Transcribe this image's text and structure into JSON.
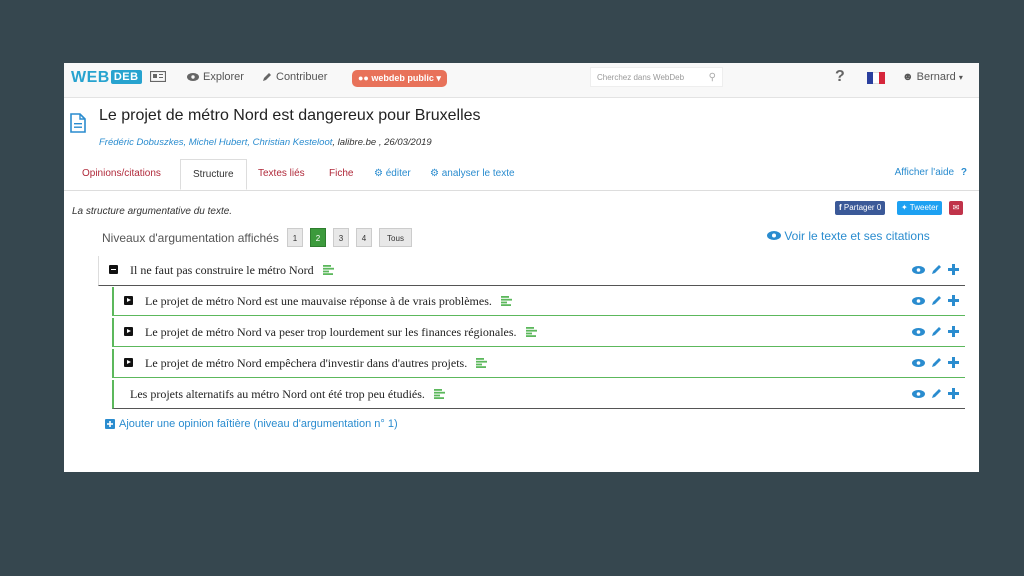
{
  "nav": {
    "logo_web": "WEB",
    "logo_deb": "DEB",
    "explorer": "Explorer",
    "contribuer": "Contribuer",
    "group_pill": "webdeb public",
    "search_placeholder": "Cherchez dans WebDeb",
    "help": "?",
    "user": "Bernard"
  },
  "document": {
    "title": "Le projet de métro Nord est dangereux pour Bruxelles",
    "authors": "Frédéric Dobuszkes, Michel Hubert, Christian Kesteloot",
    "source": ", lalibre.be , 26/03/2019"
  },
  "tabs": [
    {
      "label": "Opinions/citations"
    },
    {
      "label": "Structure"
    },
    {
      "label": "Textes liés"
    },
    {
      "label": "Fiche"
    },
    {
      "label": "éditer"
    },
    {
      "label": "analyser le texte"
    }
  ],
  "help_label": "Afficher l'aide",
  "description": "La structure argumentative du texte.",
  "share": {
    "facebook": "Partager 0",
    "twitter": "Tweeter"
  },
  "levels": {
    "label": "Niveaux d'argumentation affichés",
    "options": [
      "1",
      "2",
      "3",
      "4",
      "Tous"
    ],
    "selected": "2"
  },
  "voir_link": "Voir le texte et ses citations",
  "arguments": [
    {
      "text": "Il ne faut pas construire le métro Nord"
    },
    {
      "text": "Le projet de métro Nord est une mauvaise réponse à de vrais problèmes."
    },
    {
      "text": "Le projet de métro Nord va peser trop lourdement sur les finances régionales."
    },
    {
      "text": "Le projet de métro Nord empêchera d'investir dans d'autres projets."
    },
    {
      "text": "Les projets alternatifs au métro Nord ont été trop peu étudiés."
    }
  ],
  "add_opinion": "Ajouter une opinion faîtière (niveau d'argumentation n° 1)",
  "colors": {
    "accent": "#2a8ccf",
    "tab_red": "#b0293a",
    "green": "#5cb85c",
    "pill": "#e8725a"
  }
}
